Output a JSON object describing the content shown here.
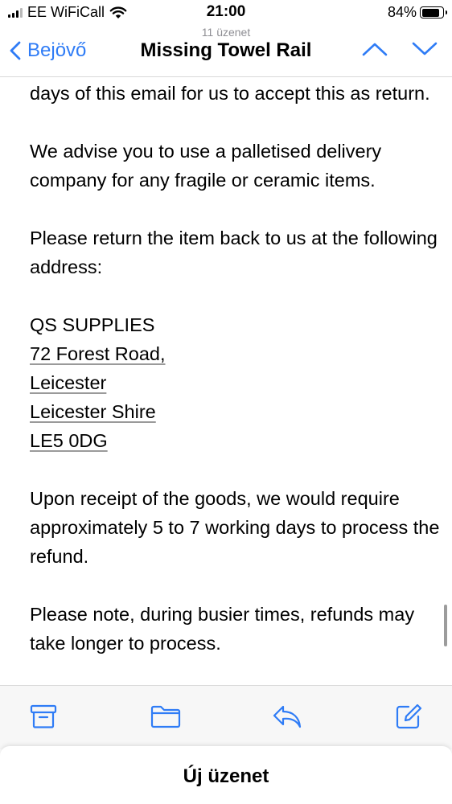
{
  "status_bar": {
    "carrier": "EE WiFiCall",
    "time": "21:00",
    "battery": "84%",
    "battery_level": 0.84
  },
  "nav": {
    "back_label": "Bejövő",
    "message_count": "11 üzenet",
    "title": "Missing Towel Rail",
    "icons": [
      "chevron-left-icon",
      "chevron-up-icon",
      "chevron-down-icon"
    ]
  },
  "email": {
    "paragraph_1": "days of this email for us to accept this as return.",
    "paragraph_2": "We advise you to use a palletised delivery company for any fragile or ceramic items.",
    "paragraph_3": "Please return the item back to us at the following address:",
    "address": {
      "company": "QS SUPPLIES",
      "street": "72 Forest Road,",
      "city": "Leicester",
      "county": "Leicester Shire",
      "postcode": "LE5 0DG"
    },
    "paragraph_4": "Upon receipt of the goods, we would require approximately 5 to 7 working days to process the refund.",
    "paragraph_5": "Please note, during busier times, refunds may take longer to process."
  },
  "toolbar": {
    "icons": [
      "archive-icon",
      "folder-icon",
      "reply-icon",
      "compose-icon"
    ]
  },
  "sheet": {
    "title": "Új üzenet"
  },
  "colors": {
    "accent": "#2f7cf6",
    "toolbar_bg": "#f7f7f7",
    "secondary_text": "#8e8e93"
  }
}
